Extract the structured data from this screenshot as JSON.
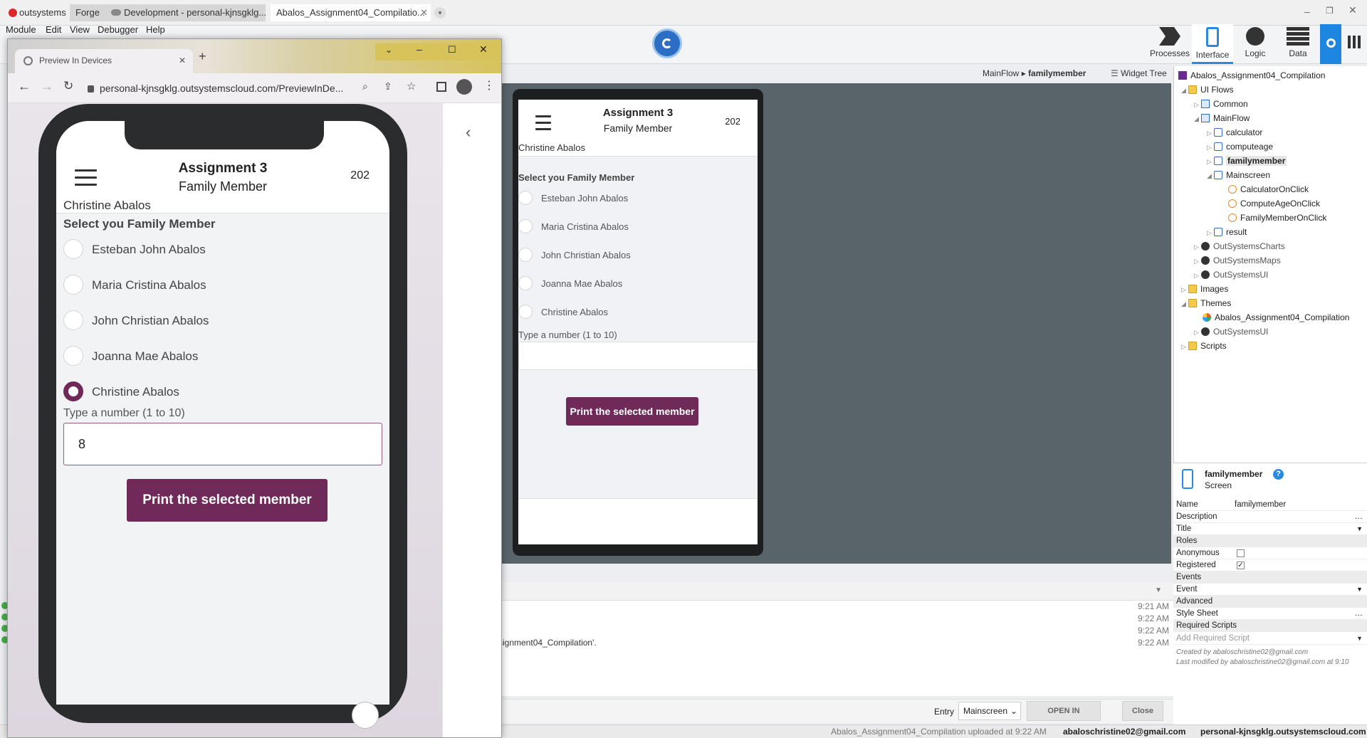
{
  "ide": {
    "tabs": [
      "outsystems",
      "Forge",
      "Development - personal-kjnsgklg...",
      "Abalos_Assignment04_Compilatio..."
    ],
    "menu": [
      "Module",
      "Edit",
      "View",
      "Debugger",
      "Help"
    ],
    "toolbar": [
      {
        "label": "Processes",
        "icon": "processes-icon"
      },
      {
        "label": "Interface",
        "icon": "phone-icon"
      },
      {
        "label": "Logic",
        "icon": "logic-icon"
      },
      {
        "label": "Data",
        "icon": "data-icon"
      }
    ],
    "breadcrumb": {
      "flow": "MainFlow",
      "screen": "familymember"
    },
    "widget_tree_label": "Widget Tree"
  },
  "tree": {
    "module": "Abalos_Assignment04_Compilation",
    "ui_flows": "UI Flows",
    "common": "Common",
    "mainflow": "MainFlow",
    "screens": [
      "calculator",
      "computeage",
      "familymember"
    ],
    "mainscreen": "Mainscreen",
    "actions": [
      "CalculatorOnClick",
      "ComputeAgeOnClick",
      "FamilyMemberOnClick"
    ],
    "result": "result",
    "modules": [
      "OutSystemsCharts",
      "OutSystemsMaps",
      "OutSystemsUI"
    ],
    "images": "Images",
    "themes": "Themes",
    "theme_items": [
      "Abalos_Assignment04_Compilation",
      "OutSystemsUI"
    ],
    "scripts": "Scripts"
  },
  "props": {
    "title": "familymember",
    "subtitle": "Screen",
    "rows": [
      {
        "k": "Name",
        "v": "familymember"
      },
      {
        "k": "Description",
        "v": ""
      },
      {
        "k": "Title",
        "v": ""
      }
    ],
    "roles_label": "Roles",
    "anonymous_label": "Anonymous",
    "anonymous": false,
    "registered_label": "Registered",
    "registered": true,
    "events_label": "Events",
    "event_label": "Event",
    "advanced_label": "Advanced",
    "stylesheet_label": "Style Sheet",
    "required_scripts_label": "Required Scripts",
    "add_required_script": "Add Required Script",
    "created_by": "Created by abaloschristine02@gmail.com",
    "modified_by": "Last modified by abaloschristine02@gmail.com at 9:10"
  },
  "output": {
    "logs": [
      {
        "text": "",
        "time": "9:21 AM"
      },
      {
        "text": "",
        "time": "9:22 AM"
      },
      {
        "text": "",
        "time": "9:22 AM"
      },
      {
        "text": "signment04_Compilation'.",
        "time": "9:22 AM"
      }
    ],
    "entry_label": "Entry",
    "entry_value": "Mainscreen",
    "open_browser": "OPEN IN BROWSER",
    "close": "Close"
  },
  "status": {
    "upload": "Abalos_Assignment04_Compilation uploaded at 9:22 AM",
    "user": "abaloschristine02@gmail.com",
    "server": "personal-kjnsgklg.outsystemscloud.com"
  },
  "browser": {
    "tab_title": "Preview In Devices",
    "url": "personal-kjnsgklg.outsystemscloud.com/PreviewInDe..."
  },
  "app": {
    "title": "Assignment 3",
    "subtitle": "Family Member",
    "year": "202",
    "selected_name": "Christine Abalos",
    "select_label": "Select you Family Member",
    "options": [
      "Esteban John Abalos",
      "Maria Cristina Abalos",
      "John Christian Abalos",
      "Joanna Mae Abalos",
      "Christine Abalos"
    ],
    "selected_index": 4,
    "number_label": "Type a number (1 to 10)",
    "number_value": "8",
    "button": "Print the selected member"
  },
  "colors": {
    "accent": "#6f2a59",
    "ide_blue": "#2b8ae0"
  }
}
